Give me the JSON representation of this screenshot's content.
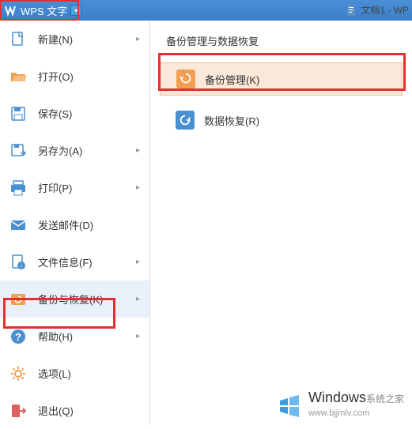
{
  "titlebar": {
    "app_name": "WPS 文字",
    "doc_title": "文档1 - WP"
  },
  "left_menu": {
    "items": [
      {
        "label": "新建(N)",
        "icon": "new-doc",
        "has_arrow": true
      },
      {
        "label": "打开(O)",
        "icon": "open-folder",
        "has_arrow": false
      },
      {
        "label": "保存(S)",
        "icon": "save",
        "has_arrow": false
      },
      {
        "label": "另存为(A)",
        "icon": "save-as",
        "has_arrow": true
      },
      {
        "label": "打印(P)",
        "icon": "print",
        "has_arrow": true
      },
      {
        "label": "发送邮件(D)",
        "icon": "mail",
        "has_arrow": false
      },
      {
        "label": "文件信息(F)",
        "icon": "file-info",
        "has_arrow": true
      },
      {
        "label": "备份与恢复(K)",
        "icon": "backup",
        "has_arrow": true,
        "selected": true
      },
      {
        "label": "帮助(H)",
        "icon": "help",
        "has_arrow": true
      },
      {
        "label": "选项(L)",
        "icon": "options",
        "has_arrow": false
      },
      {
        "label": "退出(Q)",
        "icon": "exit",
        "has_arrow": false
      }
    ]
  },
  "right_panel": {
    "title": "备份管理与数据恢复",
    "items": [
      {
        "label": "备份管理(K)",
        "icon": "backup-mgmt",
        "icon_bg": "#f0a050",
        "highlighted": true
      },
      {
        "label": "数据恢复(R)",
        "icon": "data-recovery",
        "icon_bg": "#4a90d0",
        "highlighted": false
      }
    ]
  },
  "watermark": {
    "main": "Windows",
    "sub": "系统之家",
    "url": "www.bjjmlv.com"
  }
}
